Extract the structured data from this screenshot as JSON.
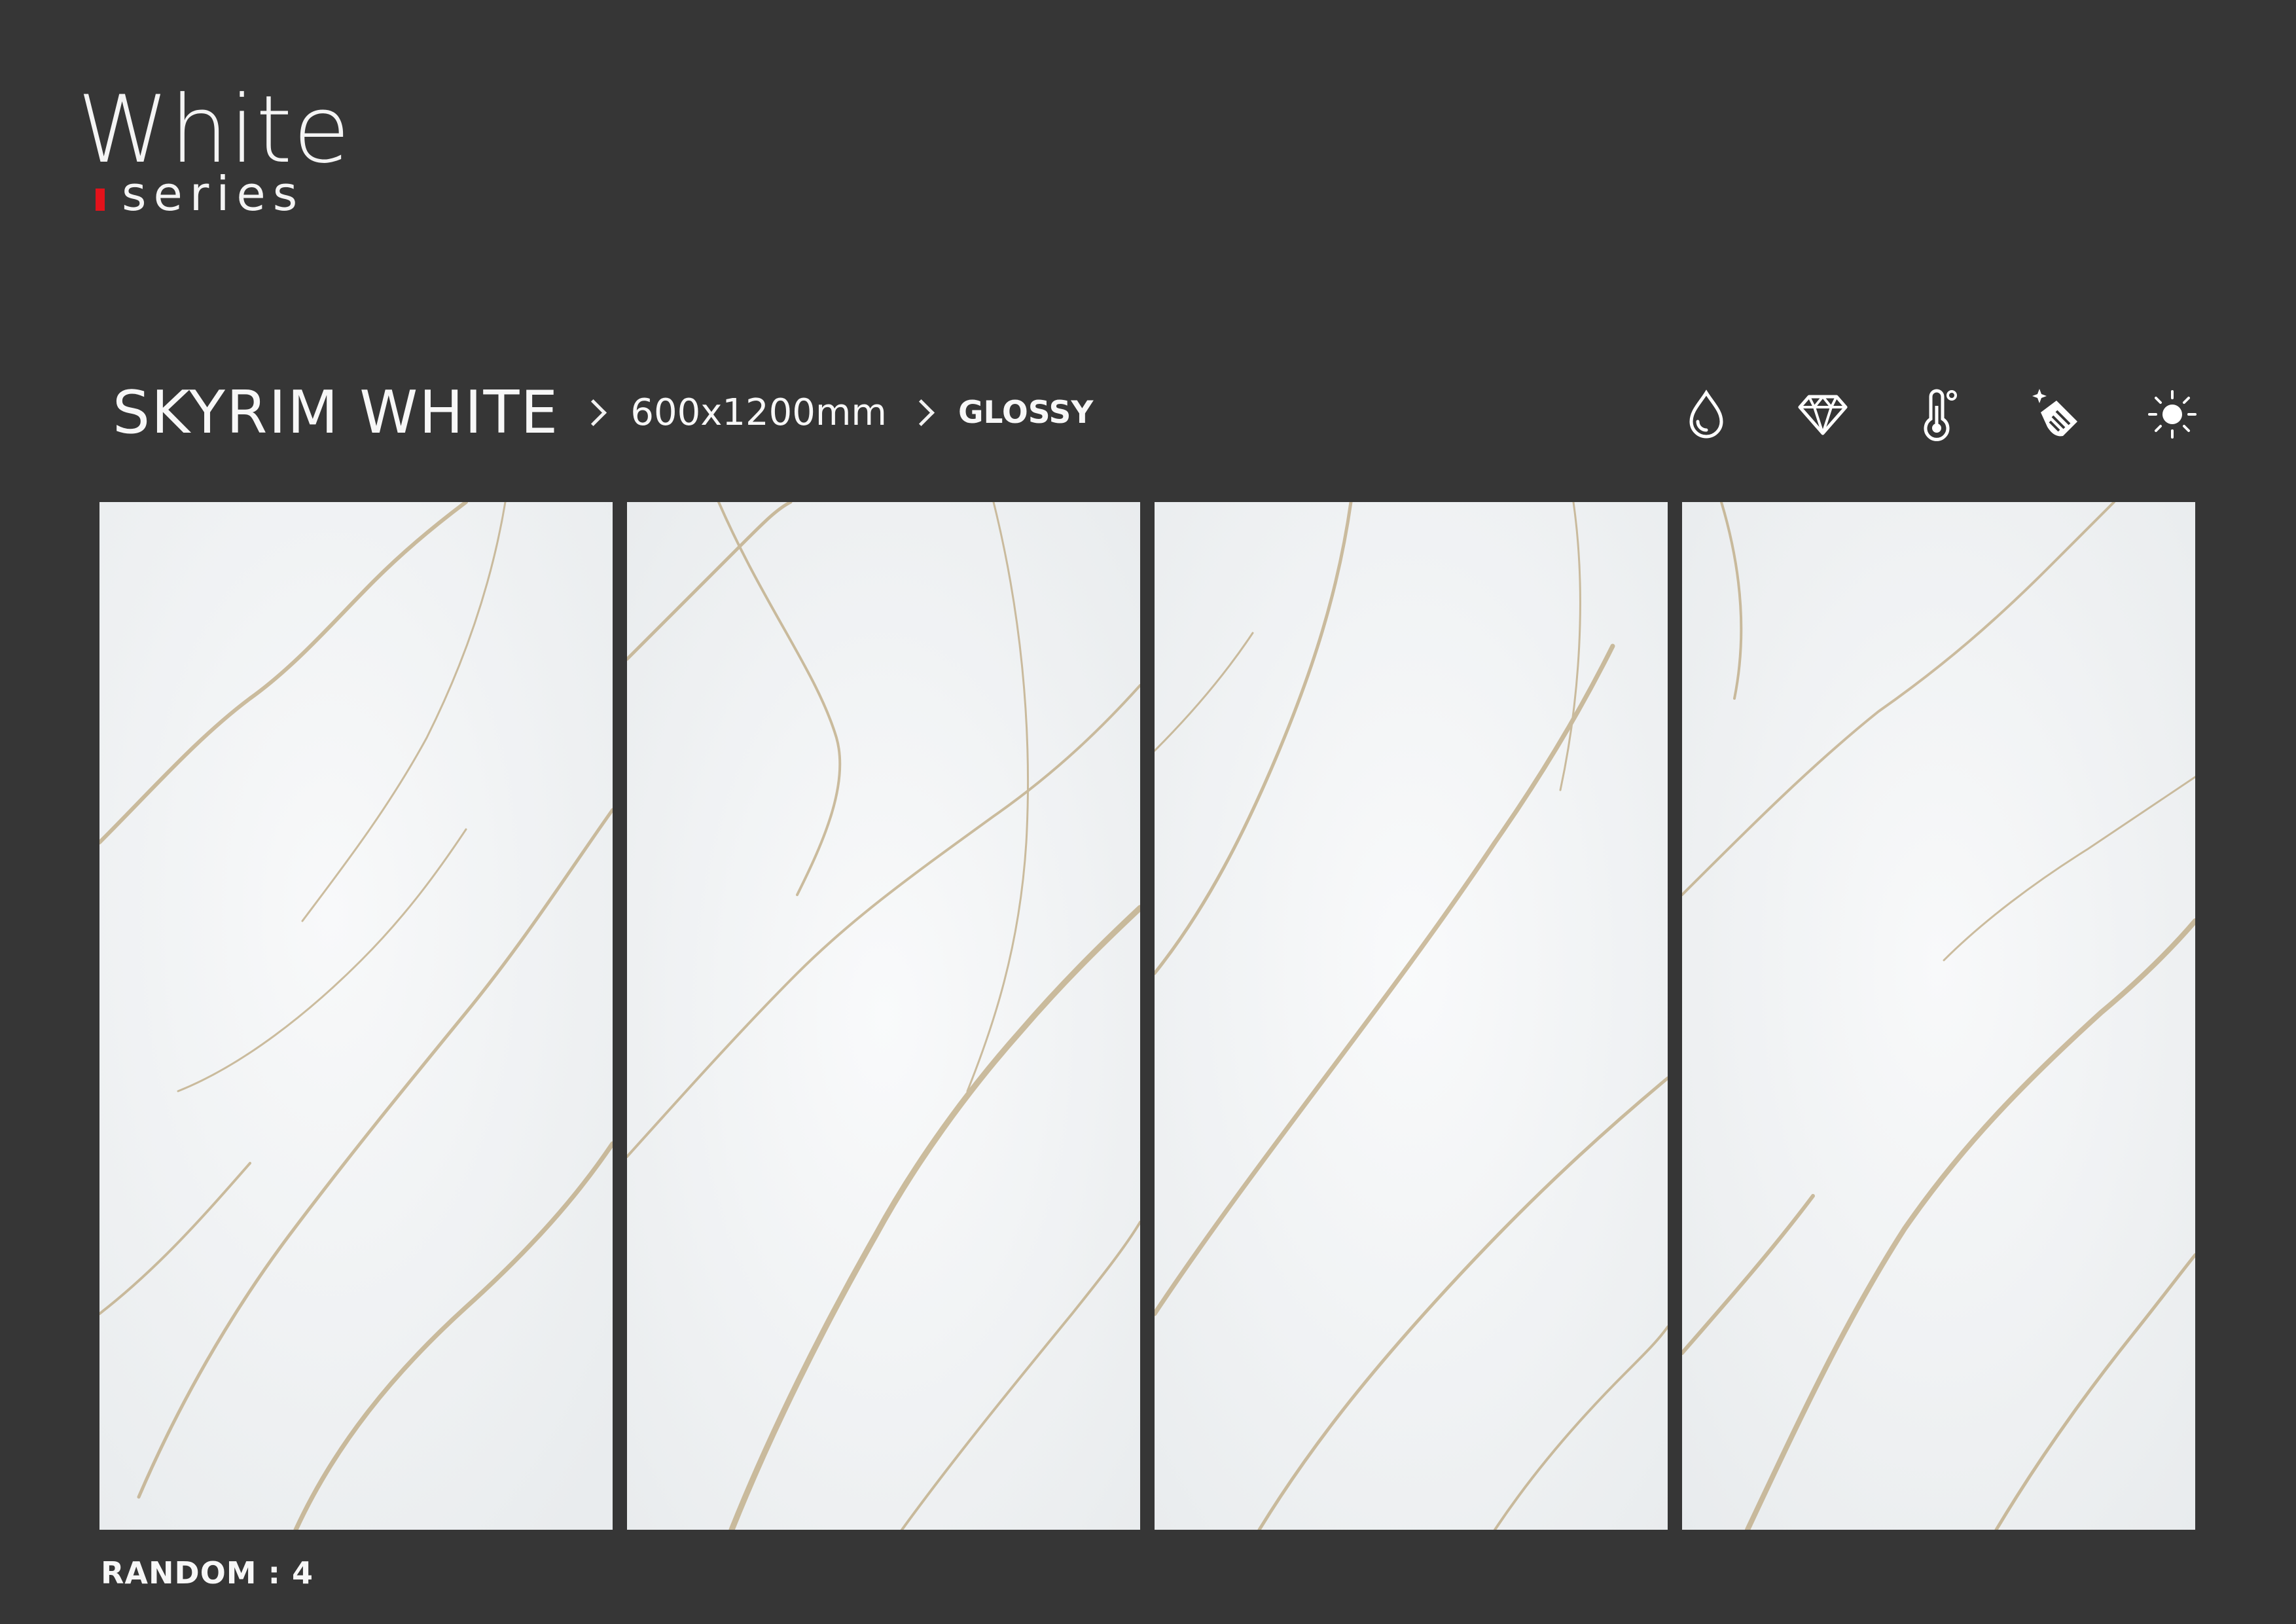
{
  "brand": {
    "title": "White",
    "subtitle": "series",
    "accent_color": "#e3121b"
  },
  "breadcrumb": {
    "product": "SKYRIM WHITE",
    "size": "600x1200mm",
    "finish": "GLOSSY"
  },
  "features": [
    {
      "icon": "water-drop-icon"
    },
    {
      "icon": "diamond-icon"
    },
    {
      "icon": "thermometer-icon"
    },
    {
      "icon": "easy-clean-hand-icon"
    },
    {
      "icon": "sun-icon"
    }
  ],
  "tiles": [
    {
      "name": "face-1"
    },
    {
      "name": "face-2"
    },
    {
      "name": "face-3"
    },
    {
      "name": "face-4"
    }
  ],
  "footer": {
    "random_label": "RANDOM : 4"
  },
  "colors": {
    "background": "#363636",
    "marble": "#f3f5f6",
    "vein": "#b59d6e"
  }
}
